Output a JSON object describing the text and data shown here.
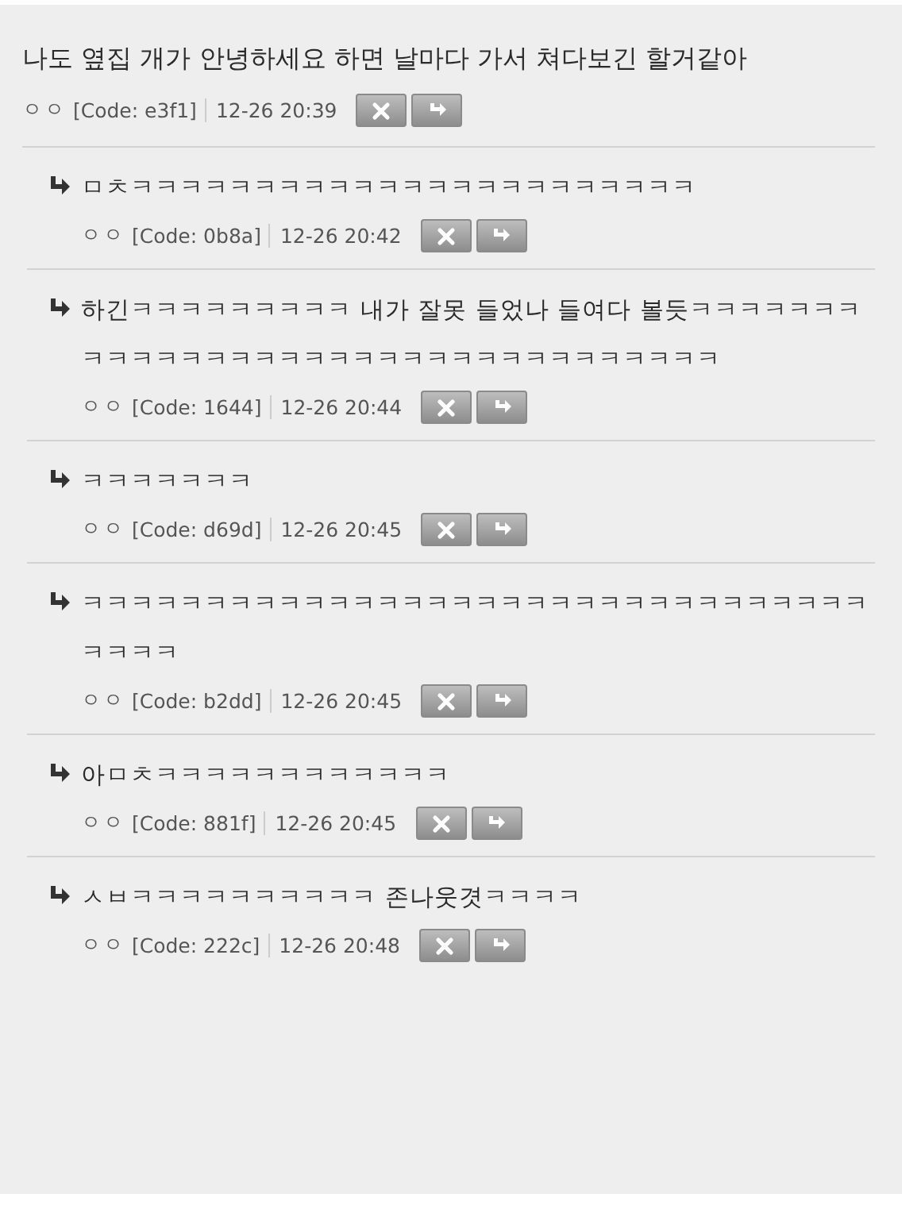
{
  "post": {
    "text": "나도 옆집 개가 안녕하세요 하면 날마다 가서 쳐다보긴 할거같아",
    "author": "ㅇㅇ",
    "code": "[Code: e3f1]",
    "time": "12-26 20:39"
  },
  "replies": [
    {
      "text": "ㅁㅊㅋㅋㅋㅋㅋㅋㅋㅋㅋㅋㅋㅋㅋㅋㅋㅋㅋㅋㅋㅋㅋㅋㅋ",
      "author": "ㅇㅇ",
      "code": "[Code: 0b8a]",
      "time": "12-26 20:42"
    },
    {
      "text": "하긴ㅋㅋㅋㅋㅋㅋㅋㅋㅋ 내가 잘못 들었나 들여다 볼듯ㅋㅋㅋㅋㅋㅋㅋㅋㅋㅋㅋㅋㅋㅋㅋㅋㅋㅋㅋㅋㅋㅋㅋㅋㅋㅋㅋㅋㅋㅋㅋㅋㅋ",
      "author": "ㅇㅇ",
      "code": "[Code: 1644]",
      "time": "12-26 20:44"
    },
    {
      "text": "ㅋㅋㅋㅋㅋㅋㅋ",
      "author": "ㅇㅇ",
      "code": "[Code: d69d]",
      "time": "12-26 20:45"
    },
    {
      "text": "ㅋㅋㅋㅋㅋㅋㅋㅋㅋㅋㅋㅋㅋㅋㅋㅋㅋㅋㅋㅋㅋㅋㅋㅋㅋㅋㅋㅋㅋㅋㅋㅋㅋㅋㅋㅋ",
      "author": "ㅇㅇ",
      "code": "[Code: b2dd]",
      "time": "12-26 20:45"
    },
    {
      "text": "아ㅁㅊㅋㅋㅋㅋㅋㅋㅋㅋㅋㅋㅋㅋ",
      "author": "ㅇㅇ",
      "code": "[Code: 881f]",
      "time": "12-26 20:45"
    },
    {
      "text": "ㅅㅂㅋㅋㅋㅋㅋㅋㅋㅋㅋㅋ 존나웃겻ㅋㅋㅋㅋ",
      "author": "ㅇㅇ",
      "code": "[Code: 222c]",
      "time": "12-26 20:48"
    }
  ]
}
